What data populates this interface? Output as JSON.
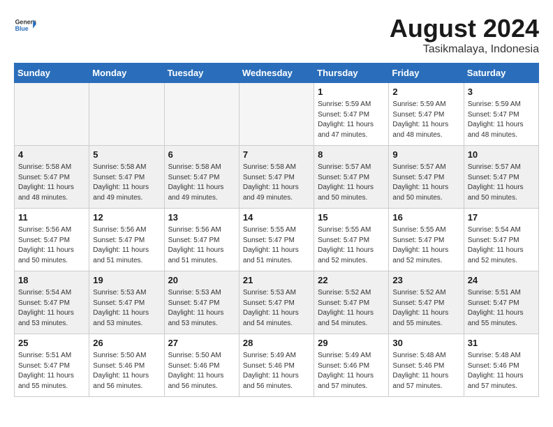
{
  "header": {
    "logo_line1": "General",
    "logo_line2": "Blue",
    "month_title": "August 2024",
    "subtitle": "Tasikmalaya, Indonesia"
  },
  "weekdays": [
    "Sunday",
    "Monday",
    "Tuesday",
    "Wednesday",
    "Thursday",
    "Friday",
    "Saturday"
  ],
  "weeks": [
    [
      {
        "day": "",
        "info": ""
      },
      {
        "day": "",
        "info": ""
      },
      {
        "day": "",
        "info": ""
      },
      {
        "day": "",
        "info": ""
      },
      {
        "day": "1",
        "info": "Sunrise: 5:59 AM\nSunset: 5:47 PM\nDaylight: 11 hours and 47 minutes."
      },
      {
        "day": "2",
        "info": "Sunrise: 5:59 AM\nSunset: 5:47 PM\nDaylight: 11 hours and 48 minutes."
      },
      {
        "day": "3",
        "info": "Sunrise: 5:59 AM\nSunset: 5:47 PM\nDaylight: 11 hours and 48 minutes."
      }
    ],
    [
      {
        "day": "4",
        "info": "Sunrise: 5:58 AM\nSunset: 5:47 PM\nDaylight: 11 hours and 48 minutes."
      },
      {
        "day": "5",
        "info": "Sunrise: 5:58 AM\nSunset: 5:47 PM\nDaylight: 11 hours and 49 minutes."
      },
      {
        "day": "6",
        "info": "Sunrise: 5:58 AM\nSunset: 5:47 PM\nDaylight: 11 hours and 49 minutes."
      },
      {
        "day": "7",
        "info": "Sunrise: 5:58 AM\nSunset: 5:47 PM\nDaylight: 11 hours and 49 minutes."
      },
      {
        "day": "8",
        "info": "Sunrise: 5:57 AM\nSunset: 5:47 PM\nDaylight: 11 hours and 50 minutes."
      },
      {
        "day": "9",
        "info": "Sunrise: 5:57 AM\nSunset: 5:47 PM\nDaylight: 11 hours and 50 minutes."
      },
      {
        "day": "10",
        "info": "Sunrise: 5:57 AM\nSunset: 5:47 PM\nDaylight: 11 hours and 50 minutes."
      }
    ],
    [
      {
        "day": "11",
        "info": "Sunrise: 5:56 AM\nSunset: 5:47 PM\nDaylight: 11 hours and 50 minutes."
      },
      {
        "day": "12",
        "info": "Sunrise: 5:56 AM\nSunset: 5:47 PM\nDaylight: 11 hours and 51 minutes."
      },
      {
        "day": "13",
        "info": "Sunrise: 5:56 AM\nSunset: 5:47 PM\nDaylight: 11 hours and 51 minutes."
      },
      {
        "day": "14",
        "info": "Sunrise: 5:55 AM\nSunset: 5:47 PM\nDaylight: 11 hours and 51 minutes."
      },
      {
        "day": "15",
        "info": "Sunrise: 5:55 AM\nSunset: 5:47 PM\nDaylight: 11 hours and 52 minutes."
      },
      {
        "day": "16",
        "info": "Sunrise: 5:55 AM\nSunset: 5:47 PM\nDaylight: 11 hours and 52 minutes."
      },
      {
        "day": "17",
        "info": "Sunrise: 5:54 AM\nSunset: 5:47 PM\nDaylight: 11 hours and 52 minutes."
      }
    ],
    [
      {
        "day": "18",
        "info": "Sunrise: 5:54 AM\nSunset: 5:47 PM\nDaylight: 11 hours and 53 minutes."
      },
      {
        "day": "19",
        "info": "Sunrise: 5:53 AM\nSunset: 5:47 PM\nDaylight: 11 hours and 53 minutes."
      },
      {
        "day": "20",
        "info": "Sunrise: 5:53 AM\nSunset: 5:47 PM\nDaylight: 11 hours and 53 minutes."
      },
      {
        "day": "21",
        "info": "Sunrise: 5:53 AM\nSunset: 5:47 PM\nDaylight: 11 hours and 54 minutes."
      },
      {
        "day": "22",
        "info": "Sunrise: 5:52 AM\nSunset: 5:47 PM\nDaylight: 11 hours and 54 minutes."
      },
      {
        "day": "23",
        "info": "Sunrise: 5:52 AM\nSunset: 5:47 PM\nDaylight: 11 hours and 55 minutes."
      },
      {
        "day": "24",
        "info": "Sunrise: 5:51 AM\nSunset: 5:47 PM\nDaylight: 11 hours and 55 minutes."
      }
    ],
    [
      {
        "day": "25",
        "info": "Sunrise: 5:51 AM\nSunset: 5:47 PM\nDaylight: 11 hours and 55 minutes."
      },
      {
        "day": "26",
        "info": "Sunrise: 5:50 AM\nSunset: 5:46 PM\nDaylight: 11 hours and 56 minutes."
      },
      {
        "day": "27",
        "info": "Sunrise: 5:50 AM\nSunset: 5:46 PM\nDaylight: 11 hours and 56 minutes."
      },
      {
        "day": "28",
        "info": "Sunrise: 5:49 AM\nSunset: 5:46 PM\nDaylight: 11 hours and 56 minutes."
      },
      {
        "day": "29",
        "info": "Sunrise: 5:49 AM\nSunset: 5:46 PM\nDaylight: 11 hours and 57 minutes."
      },
      {
        "day": "30",
        "info": "Sunrise: 5:48 AM\nSunset: 5:46 PM\nDaylight: 11 hours and 57 minutes."
      },
      {
        "day": "31",
        "info": "Sunrise: 5:48 AM\nSunset: 5:46 PM\nDaylight: 11 hours and 57 minutes."
      }
    ]
  ],
  "gray_rows": [
    1,
    3
  ],
  "colors": {
    "header_bg": "#2a6ebb",
    "gray_row": "#f0f0f0",
    "white_row": "#ffffff"
  }
}
